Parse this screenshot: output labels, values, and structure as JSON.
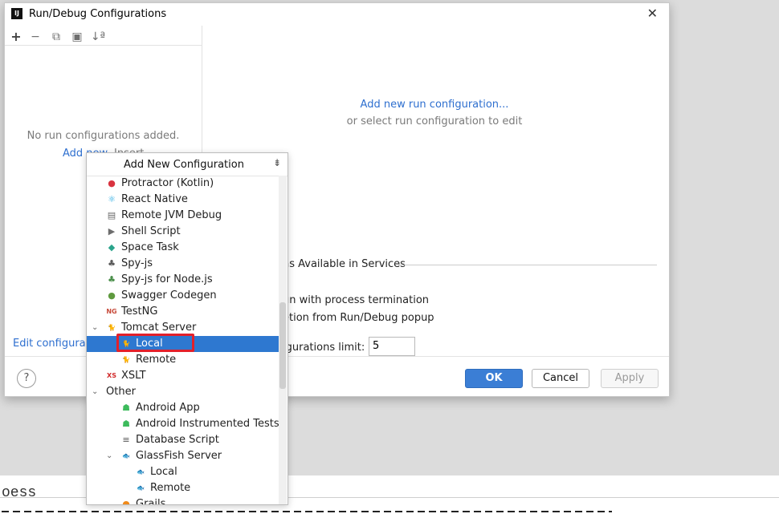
{
  "window": {
    "title": "Run/Debug Configurations",
    "icon_text": "IJ",
    "close_glyph": "✕"
  },
  "toolbar": {
    "add": "+",
    "remove": "−",
    "copy": "⧉",
    "folder": "▣",
    "sort": "↓ª"
  },
  "left_panel": {
    "empty_message": "No run configurations added.",
    "add_new_link": "Add new...",
    "insert_text": "Insert",
    "edit_config_link": "Edit configuratio"
  },
  "center": {
    "add_new_link": "Add new run configuration...",
    "subtext": "or select run configuration to edit"
  },
  "settings": {
    "services_title": "ns Available in Services",
    "option1": "un with process termination",
    "option2": "etion from Run/Debug popup",
    "limit_label": "igurations limit:",
    "limit_value": "5"
  },
  "footer": {
    "help": "?",
    "ok": "OK",
    "cancel": "Cancel",
    "apply": "Apply"
  },
  "popup": {
    "title": "Add New Configuration",
    "collapse_glyph": "⇟",
    "items": [
      {
        "label": "Protractor (Kotlin)",
        "icon_glyph": "●",
        "icon_color": "#d9333f"
      },
      {
        "label": "React Native",
        "icon_glyph": "⚛",
        "icon_color": "#1ea7e1"
      },
      {
        "label": "Remote JVM Debug",
        "icon_glyph": "▤",
        "icon_color": "#6a6a6a"
      },
      {
        "label": "Shell Script",
        "icon_glyph": "▶",
        "icon_color": "#6d6d6d"
      },
      {
        "label": "Space Task",
        "icon_glyph": "◆",
        "icon_color": "#2aa48b"
      },
      {
        "label": "Spy-js",
        "icon_glyph": "♣",
        "icon_color": "#5a5a5a"
      },
      {
        "label": "Spy-js for Node.js",
        "icon_glyph": "♣",
        "icon_color": "#4b8f4b"
      },
      {
        "label": "Swagger Codegen",
        "icon_glyph": "●",
        "icon_color": "#5f9a3f"
      },
      {
        "label": "TestNG",
        "icon_glyph": "NG",
        "icon_color": "#c74a3a"
      },
      {
        "label": "Tomcat Server",
        "icon_glyph": "🐈",
        "icon_color": "#c49a2c",
        "chevron": "⌄"
      },
      {
        "label": "Local",
        "icon_glyph": "🐈",
        "icon_color": "#c49a2c",
        "selected": true
      },
      {
        "label": "Remote",
        "icon_glyph": "🐈",
        "icon_color": "#c49a2c"
      },
      {
        "label": "XSLT",
        "icon_glyph": "XS",
        "icon_color": "#d12b2b"
      },
      {
        "label": "Other",
        "icon_glyph": "",
        "icon_color": "#666666",
        "chevron": "⌄"
      },
      {
        "label": "Android App",
        "icon_glyph": "☗",
        "icon_color": "#3dbb5c"
      },
      {
        "label": "Android Instrumented Tests",
        "icon_glyph": "☗",
        "icon_color": "#3dbb5c"
      },
      {
        "label": "Database Script",
        "icon_glyph": "≡",
        "icon_color": "#555555"
      },
      {
        "label": "GlassFish Server",
        "icon_glyph": "🐟",
        "icon_color": "#777777",
        "chevron": "⌄"
      },
      {
        "label": "Local",
        "icon_glyph": "🐟",
        "icon_color": "#777777"
      },
      {
        "label": "Remote",
        "icon_glyph": "🐟",
        "icon_color": "#777777"
      },
      {
        "label": "Grails",
        "icon_glyph": "●",
        "icon_color": "#f08a1a"
      }
    ]
  },
  "background": {
    "bottom_text": "oess"
  }
}
